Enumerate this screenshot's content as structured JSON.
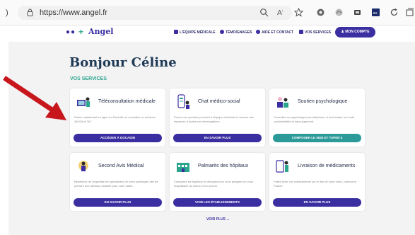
{
  "browser": {
    "url": "https://www.angel.fr",
    "back_glyph": ")"
  },
  "site": {
    "logo_text": "Angel",
    "nav": [
      "L'ÉQUIPE MÉDICALE",
      "TÉMOIGNAGES",
      "AIDE ET CONTACT",
      "VOS SERVICES"
    ],
    "account_button": "MON COMPTE"
  },
  "main": {
    "greeting": "Bonjour Céline",
    "section_label": "VOS SERVICES",
    "cards": [
      {
        "title": "Téléconsultation médicale",
        "desc": "Parlez maintenant en ligne sur Doctolib ou consultez un médecin 24h/24 et 7j/7.",
        "button": "ACCÉDER À DOCADIN",
        "button_color": "#3a2ea0"
      },
      {
        "title": "Chat médico-social",
        "desc": "Posez une question par écrit à l'équipe médicale et recevez des réponses à toutes vos interrogations.",
        "button": "EN SAVOIR PLUS",
        "button_color": "#3a2ea0"
      },
      {
        "title": "Soutien psychologique",
        "desc": "Consultez un psychologue par téléphone, à tout instant, en toute confidentialité et sans jugement.",
        "button": "COMPOSER LE 3633 ET TAPER 4",
        "button_color": "#2d9a9a"
      },
      {
        "title": "Second Avis Médical",
        "desc": "Bénéficiez de l'expertise de spécialistes de votre pathologie afin de prendre une décision éclairée pour votre santé.",
        "button": "EN SAVOIR PLUS",
        "button_color": "#3a2ea0"
      },
      {
        "title": "Palmarès des hôpitaux",
        "desc": "Comparez les hôpitaux et cliniques pour vous préparer ou vous hospitaliser au mieux et en proche.",
        "button": "VOIR LES ÉTABLISSEMENTS",
        "button_color": "#3a2ea0"
      },
      {
        "title": "Livraison de médicaments",
        "desc": "Faites livrer vos médicaments sur le lieu de votre choix, partout en France.",
        "button": "EN SAVOIR PLUS",
        "button_color": "#3a2ea0"
      }
    ],
    "voir_plus": "VOIR PLUS ⌄"
  },
  "colors": {
    "brand_purple": "#3a2ea0",
    "accent_teal": "#2ca58d",
    "annotation_red": "#c8161d"
  }
}
